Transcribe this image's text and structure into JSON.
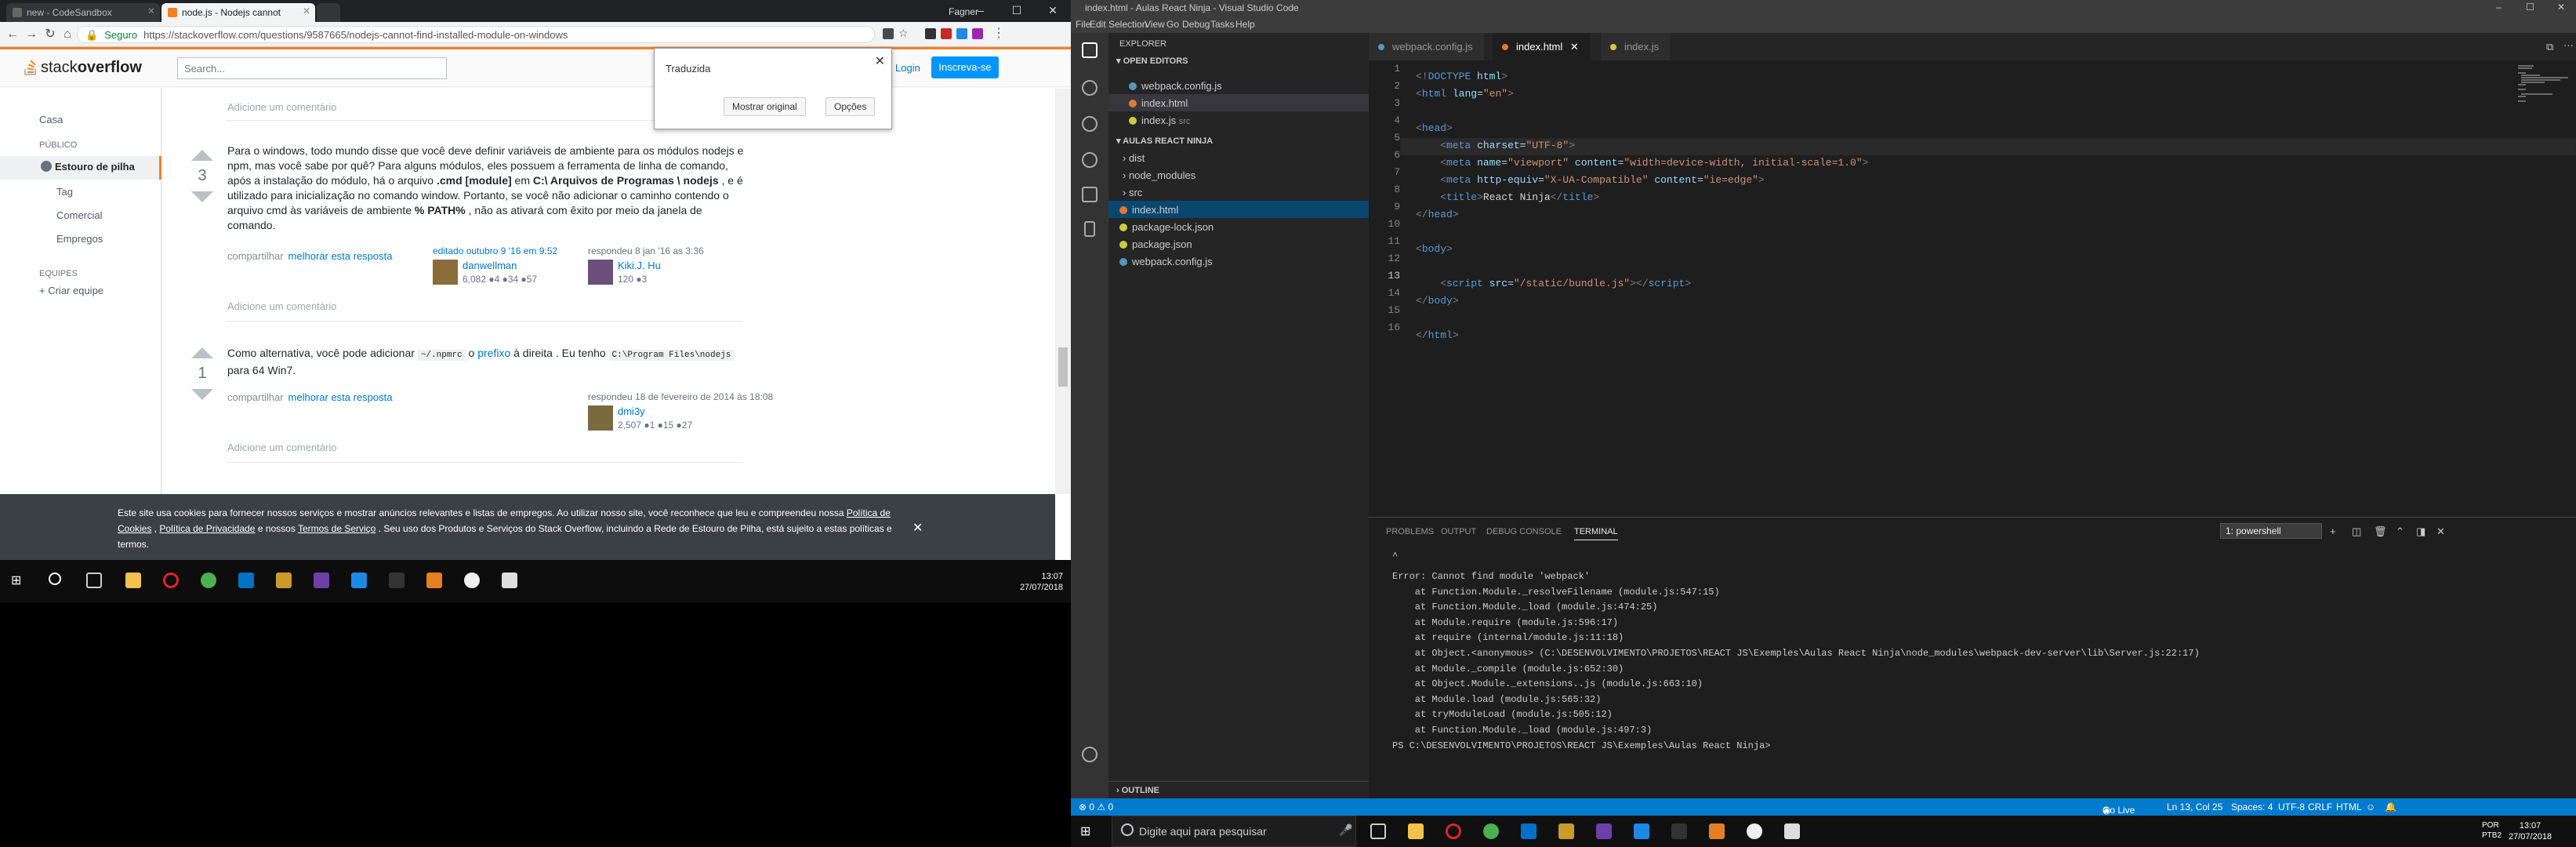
{
  "chrome": {
    "tabs": [
      {
        "label": "new - CodeSandbox",
        "active": false
      },
      {
        "label": "node.js - Nodejs cannot",
        "active": true
      }
    ],
    "profile": "Fagner",
    "secure_label": "Seguro",
    "url": "https://stackoverflow.com/questions/9587665/nodejs-cannot-find-installed-module-on-windows"
  },
  "so": {
    "logo_text_a": "stack",
    "logo_text_b": "overflow",
    "search_placeholder": "Search...",
    "login": "Login",
    "signup": "Inscreva-se",
    "translate": {
      "title": "Traduzida",
      "show_original": "Mostrar original",
      "options": "Opções"
    },
    "sidebar": {
      "home": "Casa",
      "public": "PÚBLICO",
      "stack_label": "Estouro de pilha",
      "tags": "Tag",
      "commercial": "Comercial",
      "jobs": "Empregos",
      "teams": "EQUIPES",
      "create_team": "Criar equipe"
    },
    "add_comment": "Adicione um comentário",
    "answer1": {
      "votes": "3",
      "p1": "Para o windows, todo mundo disse que você deve definir variáveis de ambiente para os módulos nodejs e npm, mas você sabe por quê? Para alguns módulos, eles possuem a ferramenta de linha de comando, após a instalação do módulo, há o arquivo",
      "cmd": ".cmd [module]",
      "p2": "em",
      "path": "C:\\ Arquivos de Programas \\ nodejs",
      "p3": ", e é utilizado para inicialização no comando window. Portanto, se você não adicionar o caminho contendo o arquivo cmd às variáveis de ambiente",
      "pathvar": "% PATH%",
      "p4": ", não as ativará com êxito por meio da janela de comando.",
      "share": "compartilhar",
      "improve": "melhorar esta resposta",
      "edited": "editado outubro 9 '16 em 9:52",
      "editor": "danwellman",
      "editor_rep": "6,082 ●4 ●34 ●57",
      "answered": "respondeu 8 jan '16 as 3:36",
      "author": "Kiki.J. Hu",
      "author_rep": "120 ●3"
    },
    "answer2": {
      "votes": "1",
      "p1": "Como alternativa, você pode adicionar",
      "code1": "~/.npmrc",
      "p2": "o",
      "prefix": "prefixo",
      "p3": "à direita . Eu tenho",
      "code2": "C:\\Program Files\\nodejs",
      "p4": "para 64 Win7.",
      "share": "compartilhar",
      "improve": "melhorar esta resposta",
      "answered": "respondeu 18 de fevereiro de 2014 às 18:08",
      "author": "dmi3y",
      "author_rep": "2,507 ●1 ●15 ●27"
    },
    "cookie": {
      "t1": "Este site usa cookies para fornecer nossos serviços e mostrar anúncios relevantes e listas de empregos. Ao utilizar nosso site, você reconhece que leu e compreendeu nossa",
      "l1": "Política de Cookies",
      "t2": ",",
      "l2": "Política de Privacidade",
      "t3": "e nossos",
      "l3": "Termos de Serviço",
      "t4": ". Seu uso dos Produtos e Serviços do Stack Overflow, incluindo a Rede de Estouro de Pilha, está sujeito a estas políticas e termos."
    }
  },
  "left_taskbar": {
    "time": "13:07",
    "date": "27/07/2018"
  },
  "vscode": {
    "title": "index.html - Aulas React Ninja - Visual Studio Code",
    "menu": [
      "File",
      "Edit",
      "Selection",
      "View",
      "Go",
      "Debug",
      "Tasks",
      "Help"
    ],
    "explorer_label": "EXPLORER",
    "open_editors_label": "OPEN EDITORS",
    "open_editors": [
      {
        "name": "webpack.config.js",
        "extra": ""
      },
      {
        "name": "index.html",
        "extra": ""
      },
      {
        "name": "index.js",
        "extra": "src"
      }
    ],
    "project_label": "AULAS REACT NINJA",
    "tree": [
      {
        "name": "dist",
        "type": "folder"
      },
      {
        "name": "node_modules",
        "type": "folder"
      },
      {
        "name": "src",
        "type": "folder"
      },
      {
        "name": "index.html",
        "type": "html"
      },
      {
        "name": "package-lock.json",
        "type": "json"
      },
      {
        "name": "package.json",
        "type": "json"
      },
      {
        "name": "webpack.config.js",
        "type": "js"
      }
    ],
    "outline_label": "OUTLINE",
    "tabs": [
      "webpack.config.js",
      "index.html",
      "index.js"
    ],
    "line_numbers": [
      "1",
      "2",
      "3",
      "4",
      "5",
      "6",
      "7",
      "8",
      "9",
      "10",
      "11",
      "12",
      "13",
      "14",
      "15",
      "16"
    ],
    "panel_tabs": [
      "PROBLEMS",
      "OUTPUT",
      "DEBUG CONSOLE",
      "TERMINAL"
    ],
    "terminal_select": "1: powershell",
    "terminal_lines": [
      "Error: Cannot find module 'webpack'",
      "    at Function.Module._resolveFilename (module.js:547:15)",
      "    at Function.Module._load (module.js:474:25)",
      "    at Module.require (module.js:596:17)",
      "    at require (internal/module.js:11:18)",
      "    at Object.<anonymous> (C:\\DESENVOLVIMENTO\\PROJETOS\\REACT JS\\Exemples\\Aulas React Ninja\\node_modules\\webpack-dev-server\\lib\\Server.js:22:17)",
      "    at Module._compile (module.js:652:30)",
      "    at Object.Module._extensions..js (module.js:663:10)",
      "    at Module.load (module.js:565:32)",
      "    at tryModuleLoad (module.js:505:12)",
      "    at Function.Module._load (module.js:497:3)",
      "PS C:\\DESENVOLVIMENTO\\PROJETOS\\REACT JS\\Exemples\\Aulas React Ninja> "
    ],
    "status": {
      "problems": "⊗ 0 ⚠ 0",
      "golive": "Go Live",
      "position": "Ln 13, Col 25",
      "spaces": "Spaces: 4",
      "encoding": "UTF-8",
      "eol": "CRLF",
      "language": "HTML"
    }
  },
  "right_taskbar": {
    "search_placeholder": "Digite aqui para pesquisar",
    "lang": "POR PTB2",
    "time": "13:07",
    "date": "27/07/2018"
  },
  "colors": {
    "so_orange": "#f48024",
    "so_blue": "#0077cc",
    "vs_blue": "#007acc",
    "cookie_bg": "#3b4045"
  }
}
